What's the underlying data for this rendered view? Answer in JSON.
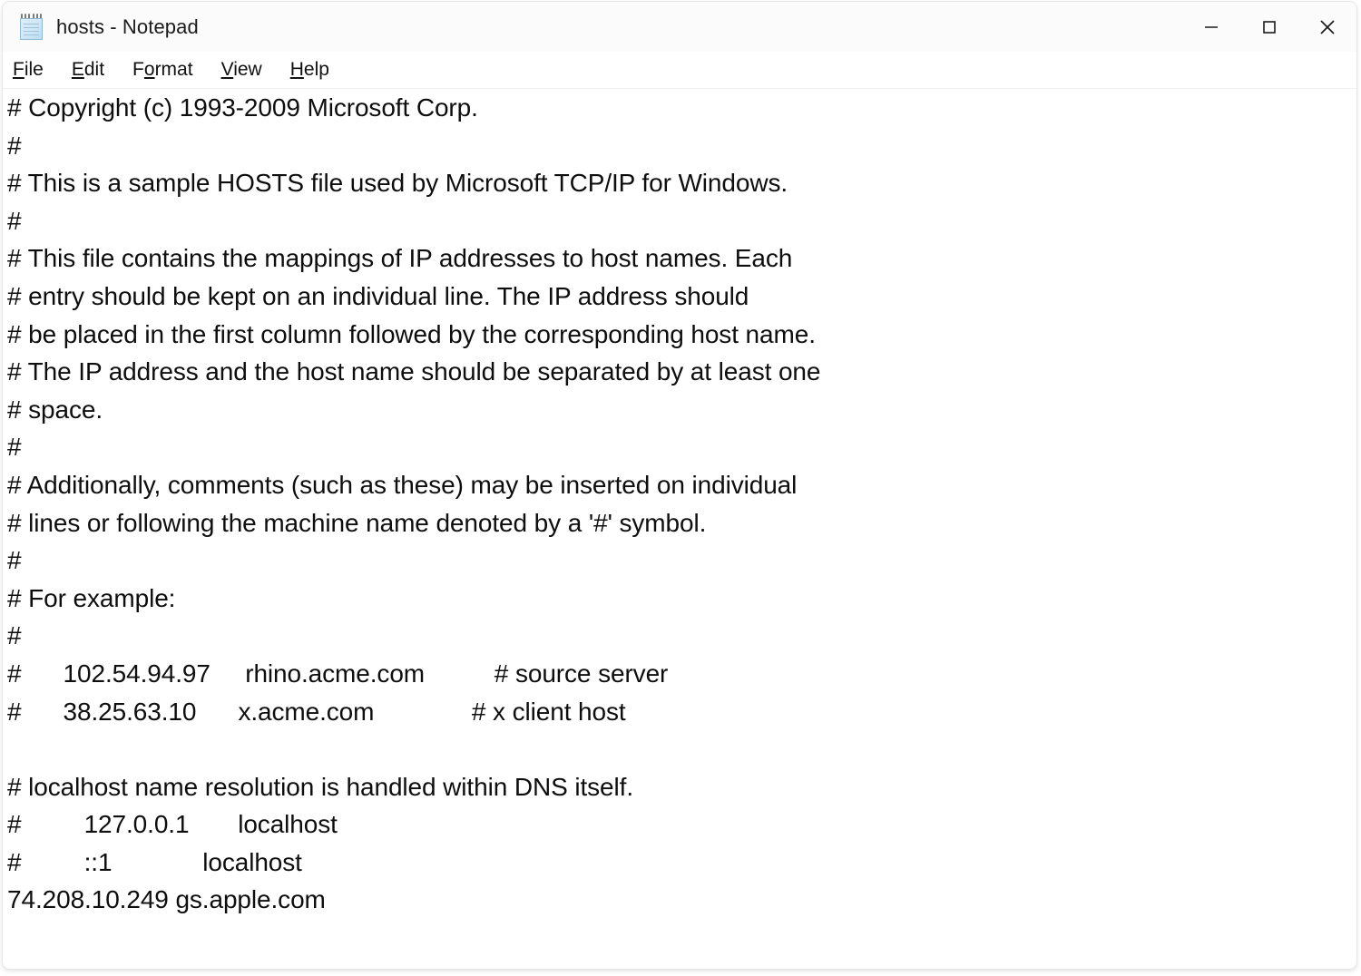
{
  "window": {
    "title": "hosts - Notepad",
    "icon": "notepad-icon",
    "controls": {
      "minimize": "minimize-icon",
      "maximize": "maximize-icon",
      "close": "close-icon"
    }
  },
  "menubar": {
    "items": [
      {
        "label": "File",
        "pre": "",
        "accel": "F",
        "post": "ile"
      },
      {
        "label": "Edit",
        "pre": "",
        "accel": "E",
        "post": "dit"
      },
      {
        "label": "Format",
        "pre": "F",
        "accel": "o",
        "post": "rmat"
      },
      {
        "label": "View",
        "pre": "",
        "accel": "V",
        "post": "iew"
      },
      {
        "label": "Help",
        "pre": "",
        "accel": "H",
        "post": "elp"
      }
    ]
  },
  "editor": {
    "filename": "hosts",
    "lines": [
      "# Copyright (c) 1993-2009 Microsoft Corp.",
      "#",
      "# This is a sample HOSTS file used by Microsoft TCP/IP for Windows.",
      "#",
      "# This file contains the mappings of IP addresses to host names. Each",
      "# entry should be kept on an individual line. The IP address should",
      "# be placed in the first column followed by the corresponding host name.",
      "# The IP address and the host name should be separated by at least one",
      "# space.",
      "#",
      "# Additionally, comments (such as these) may be inserted on individual",
      "# lines or following the machine name denoted by a '#' symbol.",
      "#",
      "# For example:",
      "#",
      "#      102.54.94.97     rhino.acme.com          # source server",
      "#      38.25.63.10      x.acme.com              # x client host",
      "",
      "# localhost name resolution is handled within DNS itself.",
      "#         127.0.0.1       localhost",
      "#         ::1             localhost",
      "74.208.10.249 gs.apple.com"
    ]
  },
  "colors": {
    "titlebar_bg": "#fbfbfb",
    "window_bg": "#ffffff",
    "text": "#0e0e0e",
    "border": "#e6e6e6"
  }
}
